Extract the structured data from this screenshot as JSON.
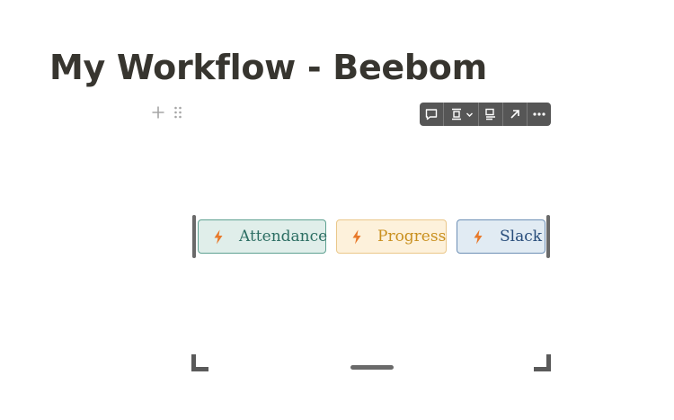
{
  "page": {
    "title": "My Workflow - Beebom"
  },
  "block_handles": {
    "add_icon": "plus-icon",
    "drag_icon": "drag-handle-icon"
  },
  "toolbar": {
    "buttons": [
      {
        "icon": "comment-icon"
      },
      {
        "icon": "align-icon",
        "has_dropdown": true
      },
      {
        "icon": "caption-icon"
      },
      {
        "icon": "open-link-icon"
      },
      {
        "icon": "more-icon"
      }
    ],
    "background": "#565656"
  },
  "buttons": [
    {
      "label": "Attendance",
      "icon": "bolt-icon",
      "text_color": "#2c6e63",
      "bg": "#e0eeea",
      "border": "#5fa191"
    },
    {
      "label": "Progress",
      "icon": "bolt-icon",
      "text_color": "#c9901f",
      "bg": "#fdf1db",
      "border": "#eac78a"
    },
    {
      "label": "Slack",
      "icon": "bolt-icon",
      "text_color": "#274c7a",
      "bg": "#e1ebf3",
      "border": "#6d8fb5"
    }
  ],
  "colors": {
    "bolt": "#e8792a",
    "title": "#37352f"
  }
}
